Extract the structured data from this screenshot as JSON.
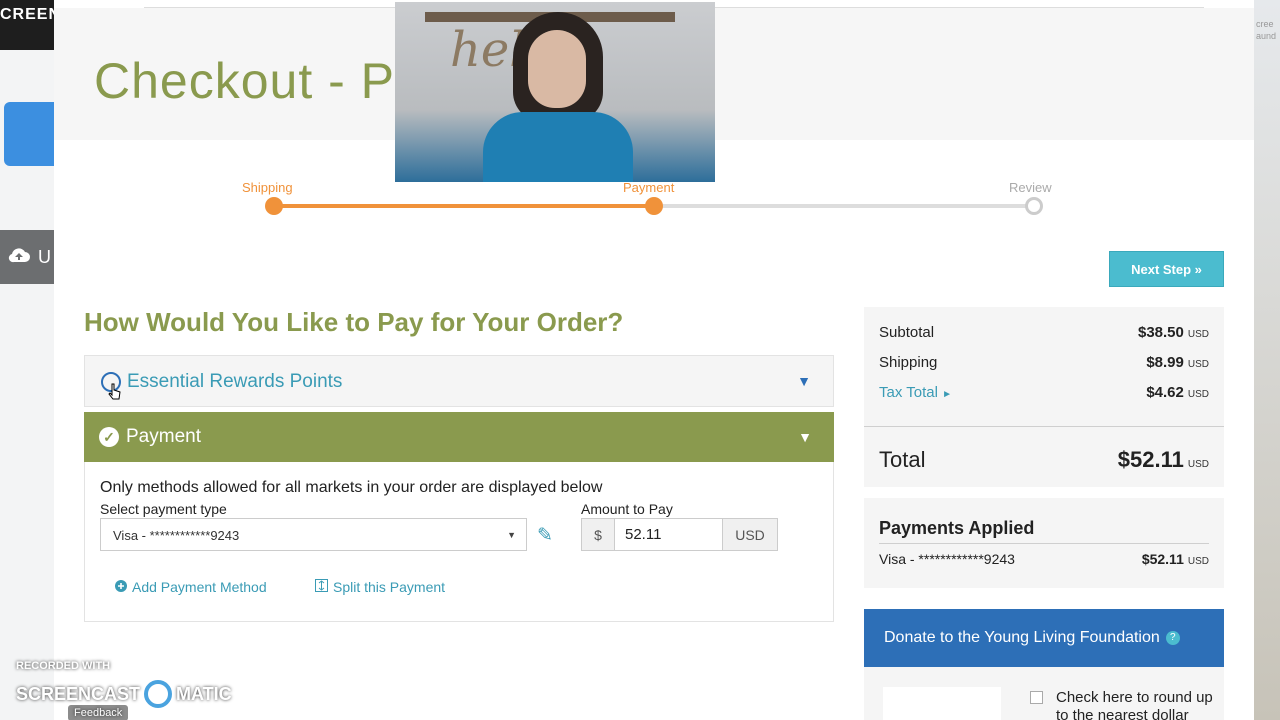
{
  "background": {
    "left_badge": "CREEN",
    "left_tab_label": "U",
    "right_text": "cree\naund"
  },
  "page": {
    "title": "Checkout - P"
  },
  "steps": [
    {
      "label": "Shipping",
      "state": "complete"
    },
    {
      "label": "Payment",
      "state": "current"
    },
    {
      "label": "Review",
      "state": "pending"
    }
  ],
  "actions": {
    "next_step": "Next Step »"
  },
  "payment_section": {
    "heading": "How Would You Like to Pay for Your Order?",
    "rewards_label": "Essential Rewards Points",
    "payment_label": "Payment",
    "notice": "Only methods allowed for all markets in your order are displayed below",
    "select_label": "Select payment type",
    "selected_method": "Visa - ************9243",
    "amount_label": "Amount to Pay",
    "currency_symbol": "$",
    "amount_value": "52.11",
    "currency_code": "USD",
    "add_method": "Add Payment Method",
    "split_payment": "Split this Payment"
  },
  "summary": {
    "subtotal_label": "Subtotal",
    "subtotal_value": "$38.50",
    "shipping_label": "Shipping",
    "shipping_value": "$8.99",
    "tax_label": "Tax Total",
    "tax_value": "$4.62",
    "total_label": "Total",
    "total_value": "$52.11",
    "currency": "USD"
  },
  "payments_applied": {
    "heading": "Payments Applied",
    "method": "Visa - ************9243",
    "amount": "$52.11",
    "currency": "USD"
  },
  "donate": {
    "title": "Donate to the Young Living Foundation",
    "help_icon": "?",
    "round_up_text": "Check here to round up to the nearest dollar"
  },
  "watermark": {
    "recorded_with": "RECORDED WITH",
    "brand_left": "SCREENCAST",
    "brand_right": "MATIC",
    "feedback": "Feedback"
  },
  "colors": {
    "brand_green": "#8a9a4e",
    "progress_orange": "#f0923a",
    "accent_teal": "#4bbccf",
    "link_blue": "#3a9bb5",
    "donate_blue": "#2d6fb7"
  }
}
